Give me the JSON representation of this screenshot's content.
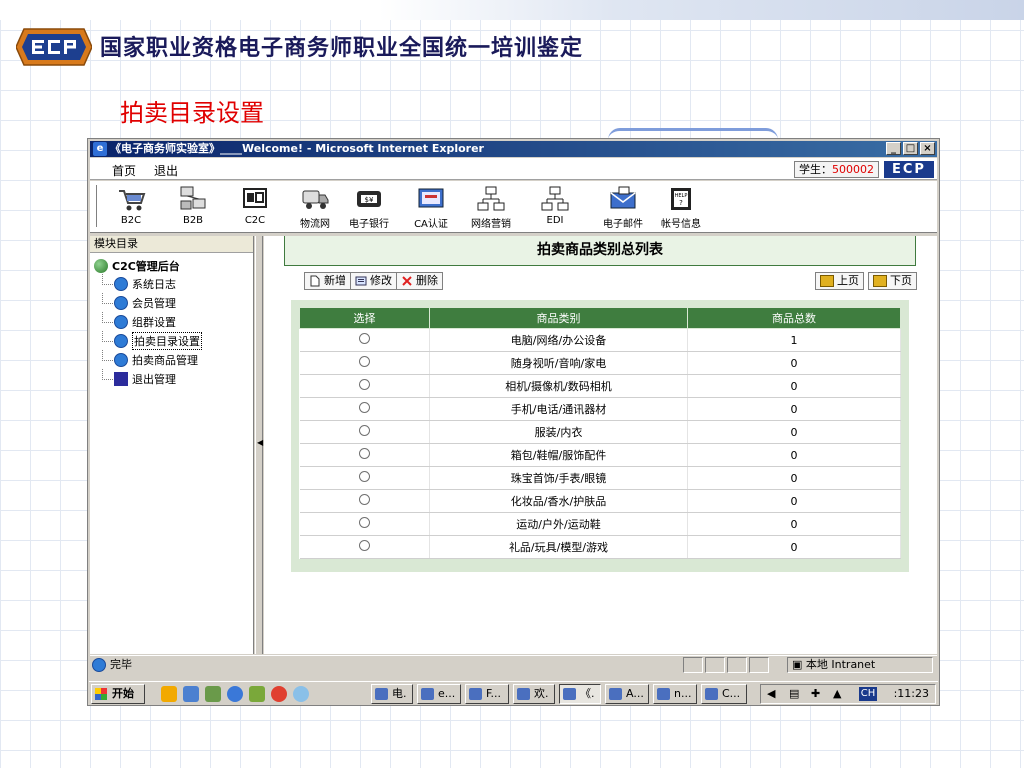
{
  "slide": {
    "title": "国家职业资格电子商务师职业全国统一培训鉴定",
    "subtitle": "拍卖目录设置"
  },
  "window": {
    "title": "《电子商务师实验室》____Welcome! - Microsoft Internet Explorer",
    "min": "_",
    "max": "□",
    "close": "×"
  },
  "menubar": {
    "home": "首页",
    "logout": "退出",
    "student_label": "学生：",
    "student_id": "500002",
    "brand": "ECP"
  },
  "toolbar": [
    {
      "label": "B2C",
      "icon": "cart-icon"
    },
    {
      "label": "B2B",
      "icon": "network-icon"
    },
    {
      "label": "C2C",
      "icon": "c2c-icon"
    },
    {
      "label": "物流网",
      "icon": "truck-icon"
    },
    {
      "label": "电子银行",
      "icon": "bank-icon"
    },
    {
      "label": "CA认证",
      "icon": "certificate-icon"
    },
    {
      "label": "网络营销",
      "icon": "marketing-icon"
    },
    {
      "label": "EDI",
      "icon": "edi-icon"
    },
    {
      "label": "电子邮件",
      "icon": "mail-icon"
    },
    {
      "label": "帐号信息",
      "icon": "help-icon"
    }
  ],
  "sidebar": {
    "header": "模块目录",
    "root": "C2C管理后台",
    "items": [
      "系统日志",
      "会员管理",
      "组群设置",
      "拍卖目录设置",
      "拍卖商品管理",
      "退出管理"
    ]
  },
  "main": {
    "heading": "拍卖商品类别总列表",
    "actions": {
      "add": "新增",
      "edit": "修改",
      "delete": "删除"
    },
    "pager": {
      "prev": "上页",
      "next": "下页"
    },
    "table": {
      "columns": [
        "选择",
        "商品类别",
        "商品总数"
      ],
      "rows": [
        {
          "category": "电脑/网络/办公设备",
          "count": "1"
        },
        {
          "category": "随身视听/音响/家电",
          "count": "0"
        },
        {
          "category": "相机/摄像机/数码相机",
          "count": "0"
        },
        {
          "category": "手机/电话/通讯器材",
          "count": "0"
        },
        {
          "category": "服装/内衣",
          "count": "0"
        },
        {
          "category": "箱包/鞋帽/服饰配件",
          "count": "0"
        },
        {
          "category": "珠宝首饰/手表/眼镜",
          "count": "0"
        },
        {
          "category": "化妆品/香水/护肤品",
          "count": "0"
        },
        {
          "category": "运动/户外/运动鞋",
          "count": "0"
        },
        {
          "category": "礼品/玩具/模型/游戏",
          "count": "0"
        }
      ]
    }
  },
  "statusbar": {
    "done": "完毕",
    "zone": "本地 Intranet"
  },
  "taskbar": {
    "start": "开始",
    "tasks": [
      "电.",
      "e...",
      "F...",
      "欢.",
      "《.",
      "A...",
      "n...",
      "C..."
    ],
    "lang": "CH",
    "clock": ":11:23"
  },
  "colors": {
    "table_header": "#3f7d3f",
    "heading_bg": "#e9f3e5",
    "subtitle": "#e00000",
    "brand": "#1a3a8c"
  }
}
